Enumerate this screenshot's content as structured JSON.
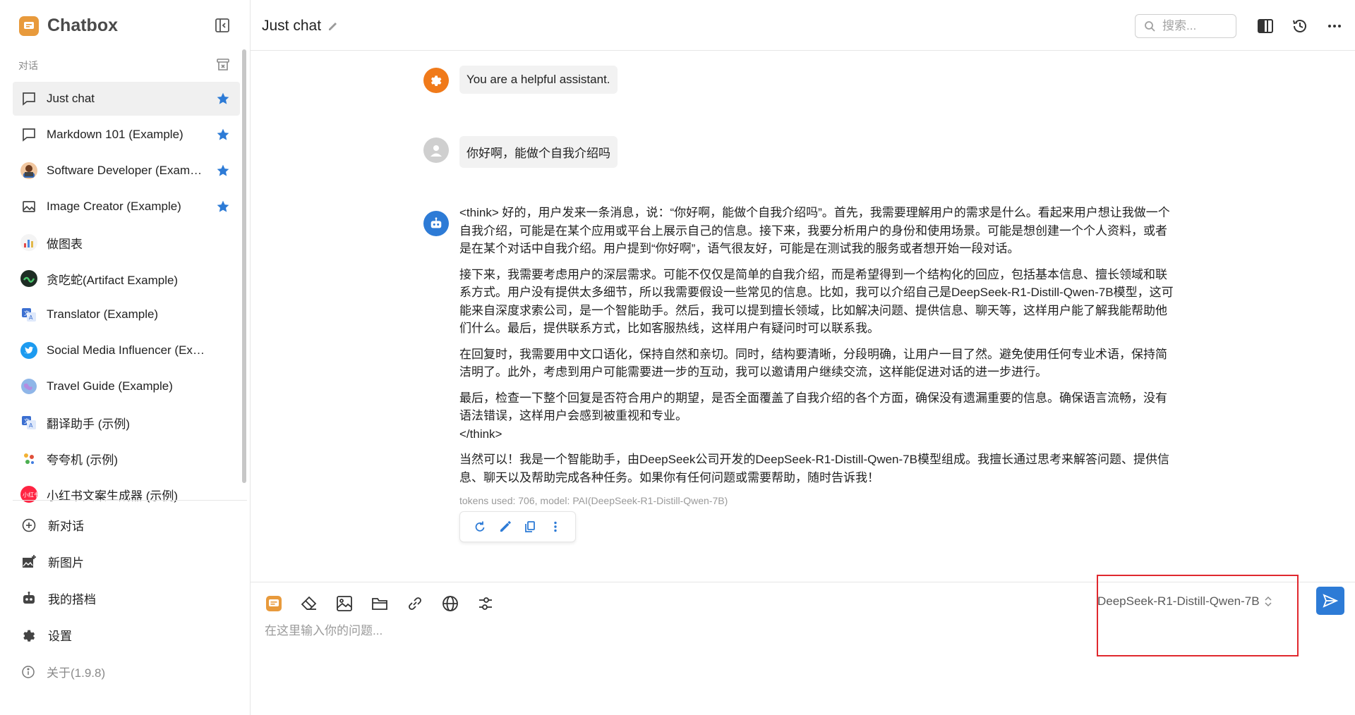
{
  "app": {
    "name": "Chatbox",
    "brand_color": "#e89a3c"
  },
  "sidebar": {
    "section_label": "对话",
    "sessions": [
      {
        "label": "Just chat",
        "icon": "chat-bubble-icon",
        "starred": true,
        "active": true
      },
      {
        "label": "Markdown 101 (Example)",
        "icon": "chat-bubble-icon",
        "starred": true
      },
      {
        "label": "Software Developer (Exam…",
        "icon": "developer-avatar",
        "starred": true
      },
      {
        "label": "Image Creator (Example)",
        "icon": "image-icon",
        "starred": true
      },
      {
        "label": "做图表",
        "icon": "chart-avatar"
      },
      {
        "label": "贪吃蛇(Artifact Example)",
        "icon": "snake-avatar"
      },
      {
        "label": "Translator (Example)",
        "icon": "translator-avatar"
      },
      {
        "label": "Social Media Influencer (Example)",
        "icon": "twitter-avatar"
      },
      {
        "label": "Travel Guide (Example)",
        "icon": "globe-avatar"
      },
      {
        "label": "翻译助手 (示例)",
        "icon": "translator-avatar"
      },
      {
        "label": "夸夸机 (示例)",
        "icon": "sparkle-avatar"
      },
      {
        "label": "小红书文案生成器 (示例)",
        "icon": "xiaohongshu-avatar"
      }
    ],
    "menu": {
      "new_chat": "新对话",
      "new_image": "新图片",
      "my_copilots": "我的搭档",
      "settings": "设置",
      "about": "关于(1.9.8)"
    }
  },
  "header": {
    "title": "Just chat",
    "search_placeholder": "搜索..."
  },
  "messages": {
    "system": "You are a helpful assistant.",
    "user": "你好啊，能做个自我介绍吗",
    "assistant": {
      "paragraphs": [
        "<think> 好的，用户发来一条消息，说：“你好啊，能做个自我介绍吗”。首先，我需要理解用户的需求是什么。看起来用户想让我做一个自我介绍，可能是在某个应用或平台上展示自己的信息。接下来，我要分析用户的身份和使用场景。可能是想创建一个个人资料，或者是在某个对话中自我介绍。用户提到“你好啊”，语气很友好，可能是在测试我的服务或者想开始一段对话。",
        "接下来，我需要考虑用户的深层需求。可能不仅仅是简单的自我介绍，而是希望得到一个结构化的回应，包括基本信息、擅长领域和联系方式。用户没有提供太多细节，所以我需要假设一些常见的信息。比如，我可以介绍自己是DeepSeek-R1-Distill-Qwen-7B模型，这可能来自深度求索公司，是一个智能助手。然后，我可以提到擅长领域，比如解决问题、提供信息、聊天等，这样用户能了解我能帮助他们什么。最后，提供联系方式，比如客服热线，这样用户有疑问时可以联系我。",
        "在回复时，我需要用中文口语化，保持自然和亲切。同时，结构要清晰，分段明确，让用户一目了然。避免使用任何专业术语，保持简洁明了。此外，考虑到用户可能需要进一步的互动，我可以邀请用户继续交流，这样能促进对话的进一步进行。",
        "最后，检查一下整个回复是否符合用户的期望，是否全面覆盖了自我介绍的各个方面，确保没有遗漏重要的信息。确保语言流畅，没有语法错误，这样用户会感到被重视和专业。",
        "当然可以！我是一个智能助手，由DeepSeek公司开发的DeepSeek-R1-Distill-Qwen-7B模型组成。我擅长通过思考来解答问题、提供信息、聊天以及帮助完成各种任务。如果你有任何问题或需要帮助，随时告诉我！"
      ],
      "think_close": "</think>",
      "meta": "tokens used: 706, model: PAI(DeepSeek-R1-Distill-Qwen-7B)"
    }
  },
  "composer": {
    "model": "DeepSeek-R1-Distill-Qwen-7B",
    "placeholder": "在这里输入你的问题..."
  },
  "colors": {
    "accent": "#2d7bd6",
    "system_avatar": "#f07a1a",
    "user_avatar": "#cfcfcf",
    "assistant_avatar": "#2d7bd6",
    "highlight": "#e0282e"
  }
}
